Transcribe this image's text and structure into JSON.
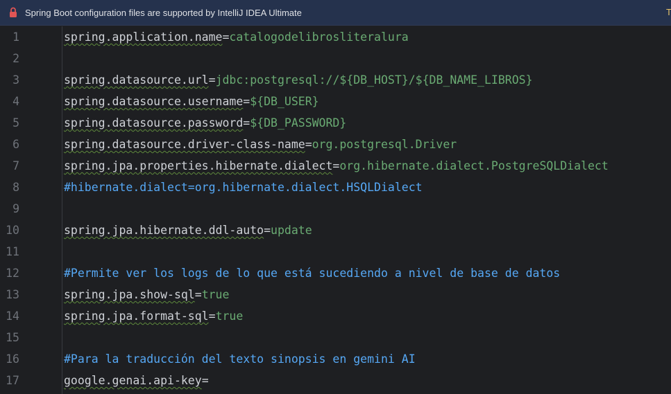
{
  "banner": {
    "message": "Spring Boot configuration files are supported by IntelliJ IDEA Ultimate",
    "action_partial": "T"
  },
  "editor": {
    "lines": [
      {
        "num": "1",
        "key": "spring.application.name",
        "eq": "=",
        "value": "catalogodelibrosliteralura",
        "comment": ""
      },
      {
        "num": "2",
        "key": "",
        "eq": "",
        "value": "",
        "comment": ""
      },
      {
        "num": "3",
        "key": "spring.datasource.url",
        "eq": "=",
        "value": "jdbc:postgresql://${DB_HOST}/${DB_NAME_LIBROS}",
        "comment": ""
      },
      {
        "num": "4",
        "key": "spring.datasource.username",
        "eq": "=",
        "value": "${DB_USER}",
        "comment": ""
      },
      {
        "num": "5",
        "key": "spring.datasource.password",
        "eq": "=",
        "value": "${DB_PASSWORD}",
        "comment": ""
      },
      {
        "num": "6",
        "key": "spring.datasource.driver-class-name",
        "eq": "=",
        "value": "org.postgresql.Driver",
        "comment": ""
      },
      {
        "num": "7",
        "key": "spring.jpa.properties.hibernate.dialect",
        "eq": "=",
        "value": "org.hibernate.dialect.PostgreSQLDialect",
        "comment": ""
      },
      {
        "num": "8",
        "key": "",
        "eq": "",
        "value": "",
        "comment": "#hibernate.dialect=org.hibernate.dialect.HSQLDialect"
      },
      {
        "num": "9",
        "key": "",
        "eq": "",
        "value": "",
        "comment": ""
      },
      {
        "num": "10",
        "key": "spring.jpa.hibernate.ddl-auto",
        "eq": "=",
        "value": "update",
        "comment": ""
      },
      {
        "num": "11",
        "key": "",
        "eq": "",
        "value": "",
        "comment": ""
      },
      {
        "num": "12",
        "key": "",
        "eq": "",
        "value": "",
        "comment": "#Permite ver los logs de lo que está sucediendo a nivel de base de datos"
      },
      {
        "num": "13",
        "key": "spring.jpa.show-sql",
        "eq": "=",
        "value": "true",
        "comment": ""
      },
      {
        "num": "14",
        "key": "spring.jpa.format-sql",
        "eq": "=",
        "value": "true",
        "comment": ""
      },
      {
        "num": "15",
        "key": "",
        "eq": "",
        "value": "",
        "comment": ""
      },
      {
        "num": "16",
        "key": "",
        "eq": "",
        "value": "",
        "comment": "#Para la traducción del texto sinopsis en gemini AI"
      },
      {
        "num": "17",
        "key": "google.genai.api-key",
        "eq": "=",
        "value": "",
        "comment": ""
      }
    ]
  },
  "colors": {
    "background": "#1e1f22",
    "banner": "#25324d",
    "key": "#cfd2d7",
    "value": "#6aab73",
    "comment": "#56a8f5",
    "line_number": "#6f737a",
    "lock": "#e05555"
  },
  "icons": {
    "banner_icon": "lock-icon"
  }
}
